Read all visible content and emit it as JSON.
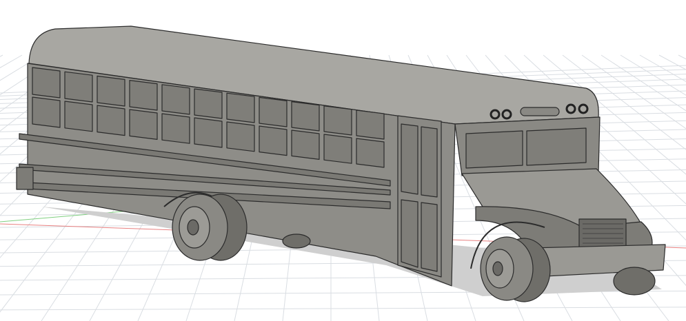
{
  "viewport": {
    "model": "school-bus",
    "colors": {
      "background": "#ffffff",
      "grid": "#d9dde2",
      "x_axis": "#e88080",
      "y_axis": "#7fcf7f",
      "body": "#8e8d88",
      "body_light": "#a8a7a2",
      "body_dark": "#6b6a66",
      "outline": "#2b2b2b",
      "window": "#7f7e79"
    }
  }
}
